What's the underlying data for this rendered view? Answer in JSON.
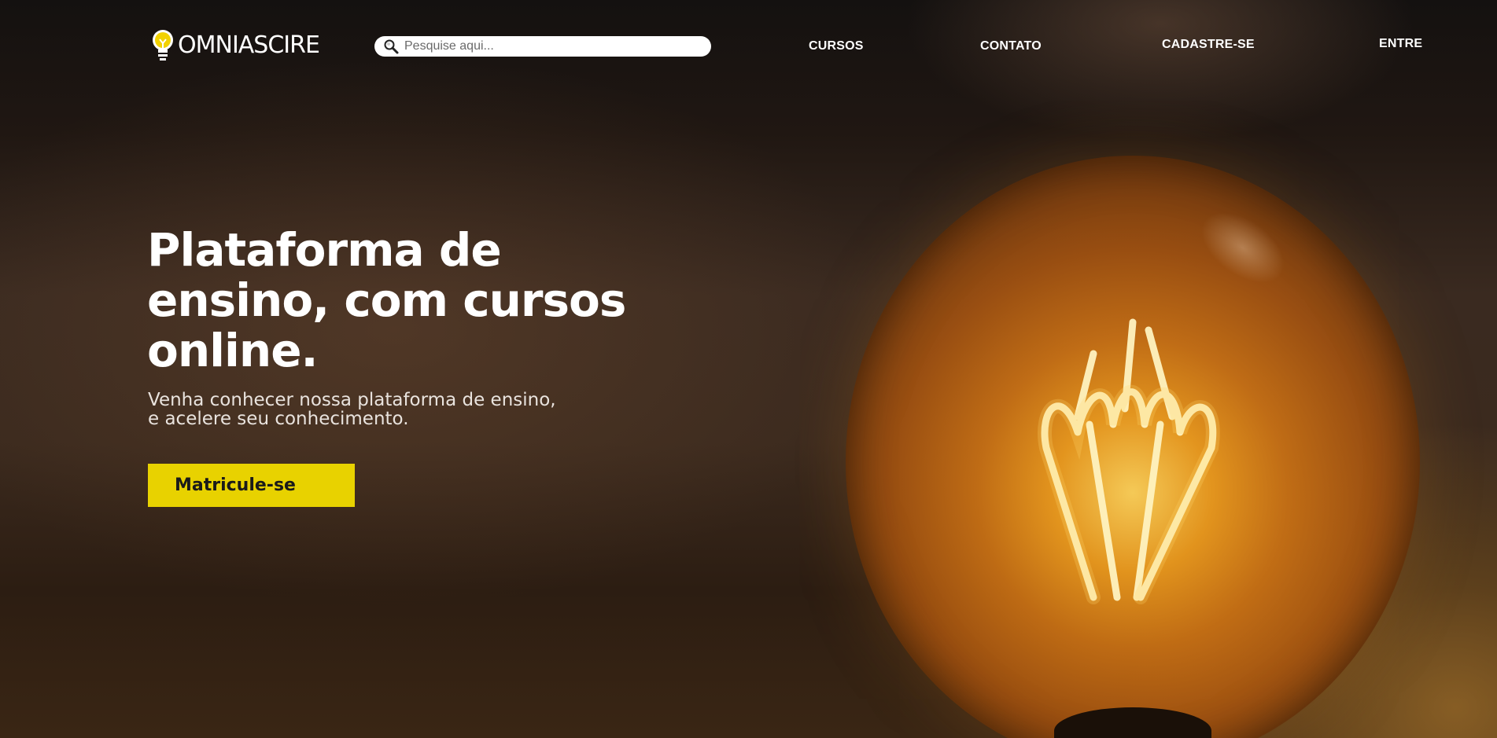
{
  "brand": {
    "name": "OMNIASCIRE",
    "icon": "lightbulb-icon",
    "accent_color": "#e8d200"
  },
  "search": {
    "placeholder": "Pesquise aqui...",
    "value": "",
    "icon": "search-icon"
  },
  "nav": {
    "items": [
      {
        "label": "CURSOS"
      },
      {
        "label": "CONTATO"
      },
      {
        "label": "CADASTRE-SE"
      },
      {
        "label": "ENTRE"
      }
    ]
  },
  "hero": {
    "title": "Plataforma de ensino, com cursos online.",
    "subtitle_line1": "Venha conhecer nossa plataforma de ensino,",
    "subtitle_line2": "e acelere seu conhecimento.",
    "cta_label": "Matricule-se",
    "cta_color": "#e8d200"
  }
}
